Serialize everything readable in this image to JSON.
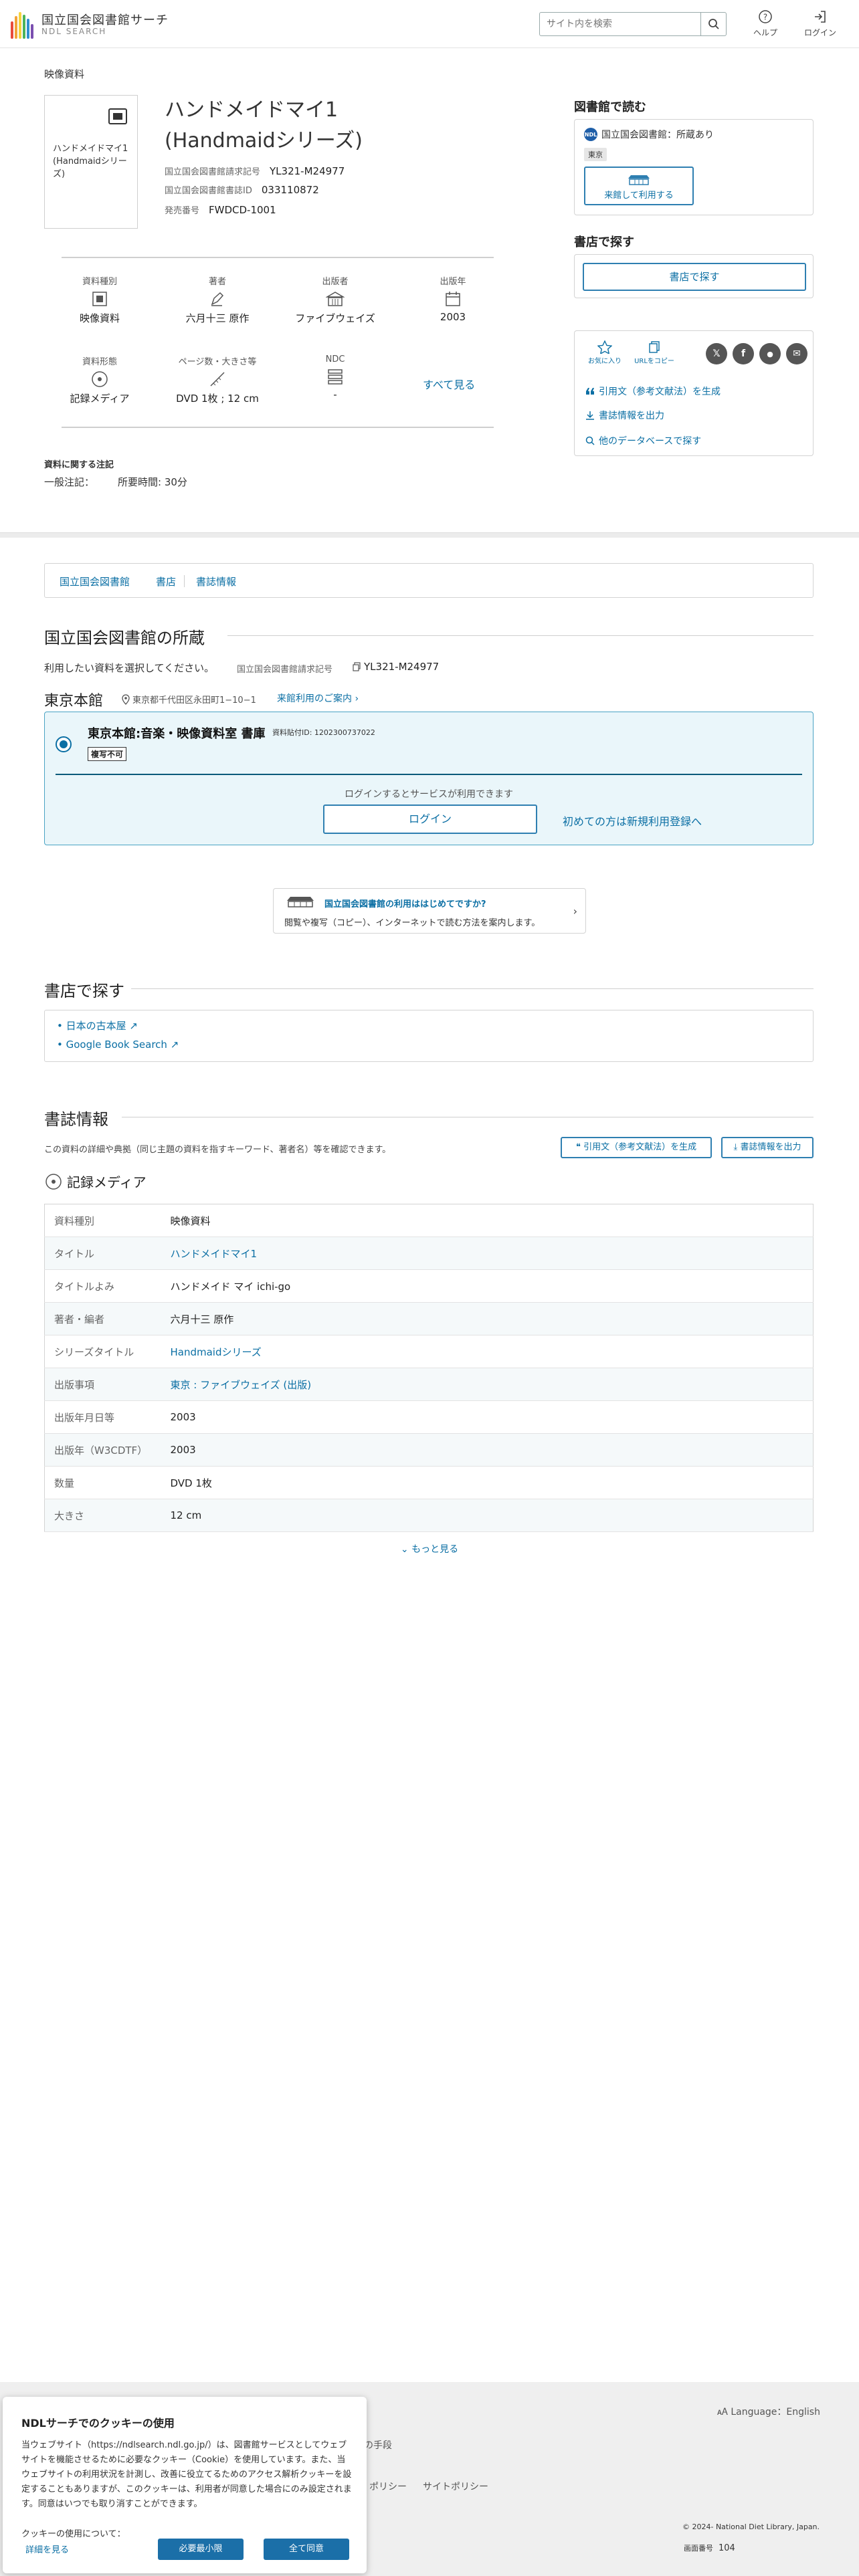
{
  "header": {
    "logo_jp": "国立国会図書館サーチ",
    "logo_en": "NDL SEARCH",
    "search_placeholder": "サイト内を検索",
    "help_label": "ヘルプ",
    "login_label": "ログイン"
  },
  "record": {
    "kind": "映像資料",
    "thumb_text": "ハンドメイドマイ1 (Handmaidシリーズ)",
    "title": "ハンドメイドマイ1 (Handmaidシリーズ)",
    "meta": [
      {
        "label": "国立国会図書館請求記号",
        "value": "YL321-M24977"
      },
      {
        "label": "国立国会図書館書誌ID",
        "value": "033110872"
      },
      {
        "label": "発売番号",
        "value": "FWDCD-1001"
      }
    ],
    "attrs": [
      {
        "label": "資料種別",
        "value": "映像資料",
        "icon": "film-icon"
      },
      {
        "label": "著者",
        "value": "六月十三 原作",
        "icon": "pen-icon"
      },
      {
        "label": "出版者",
        "value": "ファイブウェイズ",
        "icon": "building-icon"
      },
      {
        "label": "出版年",
        "value": "2003",
        "icon": "calendar-icon"
      },
      {
        "label": "資料形態",
        "value": "記録メディア",
        "icon": "disc-icon"
      },
      {
        "label": "ページ数・大きさ等",
        "value": "DVD 1枚 ; 12 cm",
        "icon": "ruler-icon"
      },
      {
        "label": "NDC",
        "value": "-",
        "icon": "books-icon"
      }
    ],
    "see_all": "すべて見る",
    "note_title": "資料に関する注記",
    "note_label": "一般注記：",
    "note_value": "所要時間: 30分"
  },
  "right": {
    "read_title": "図書館で読む",
    "ndl_badge": "NDL",
    "holding_status": "国立国会図書館：所蔵あり",
    "tag_tokyo": "東京",
    "visit_label": "来館して利用する",
    "store_title": "書店で探す",
    "store_btn": "書店で探す",
    "fav_label": "お気に入り",
    "copy_url_label": "URLをコピー",
    "cite_link": "引用文（参考文献法）を生成",
    "export_link": "書誌情報を出力",
    "other_db_link": "他のデータベースで探す"
  },
  "tabs": [
    "国立国会図書館",
    "書店",
    "書誌情報"
  ],
  "holdings": {
    "heading": "国立国会図書館の所蔵",
    "desc": "利用したい資料を選択してください。",
    "callno_label": "国立国会図書館請求記号",
    "callno": "YL321-M24977",
    "branch": "東京本館",
    "address": "東京都千代田区永田町1−10−1",
    "guide": "来館利用のご案内",
    "item_name": "東京本館:音楽・映像資料室 書庫",
    "item_id": "資料貼付ID: 1202300737022",
    "item_tag": "複写不可",
    "login_note": "ログインするとサービスが利用できます",
    "login_btn": "ログイン",
    "register": "初めての方は新規利用登録へ"
  },
  "first_card": {
    "title": "国立国会図書館の利用ははじめてですか?",
    "sub": "閲覧や複写（コピー）、インターネットで読む方法を案内します。"
  },
  "stores": {
    "heading": "書店で探す",
    "items": [
      "日本の古本屋",
      "Google Book Search"
    ]
  },
  "biblio": {
    "heading": "書誌情報",
    "desc": "この資料の詳細や典拠（同じ主題の資料を指すキーワード、著者名）等を確認できます。",
    "cite_btn": "引用文（参考文献法）を生成",
    "export_btn": "書誌情報を出力",
    "media_heading": "記録メディア",
    "rows": [
      {
        "k": "資料種別",
        "v": "映像資料",
        "link": false
      },
      {
        "k": "タイトル",
        "v": "ハンドメイドマイ1",
        "link": true
      },
      {
        "k": "タイトルよみ",
        "v": "ハンドメイド マイ ichi-go",
        "link": false
      },
      {
        "k": "著者・編者",
        "v": "六月十三 原作",
        "link": false
      },
      {
        "k": "シリーズタイトル",
        "v": "Handmaidシリーズ",
        "link": true
      },
      {
        "k": "出版事項",
        "v": "東京 : ファイブウェイズ (出版)",
        "link": true
      },
      {
        "k": "出版年月日等",
        "v": "2003",
        "link": false
      },
      {
        "k": "出版年（W3CDTF）",
        "v": "2003",
        "link": false
      },
      {
        "k": "数量",
        "v": "DVD 1枚",
        "link": false
      },
      {
        "k": "大きさ",
        "v": "12 cm",
        "link": false
      }
    ],
    "more": "もっと見る"
  },
  "footer": {
    "language": "Language：English",
    "frag1": "の手段",
    "frag2": "ポリシー",
    "frag3": "サイトポリシー",
    "copyright": "© 2024- National Diet Library, Japan.",
    "screen_label": "画面番号",
    "screen_no": "104"
  },
  "cookie": {
    "title": "NDLサーチでのクッキーの使用",
    "body": "当ウェブサイト（https://ndlsearch.ndl.go.jp/）は、図書館サービスとしてウェブサイトを機能させるために必要なクッキー（Cookie）を使用しています。また、当ウェブサイトの利用状況を計測し、改善に役立てるためのアクセス解析クッキーを設定することもありますが、このクッキーは、利用者が同意した場合にのみ設定されます。同意はいつでも取り消すことができます。",
    "question": "クッキーの使用について：",
    "details": "詳細を見る",
    "minimal_btn": "必要最小限",
    "accept_btn": "全て同意"
  },
  "colors": {
    "accent": "#0b6fa4",
    "border_accent": "#2e7fb1",
    "hold_bg": "#eaf6fa"
  }
}
